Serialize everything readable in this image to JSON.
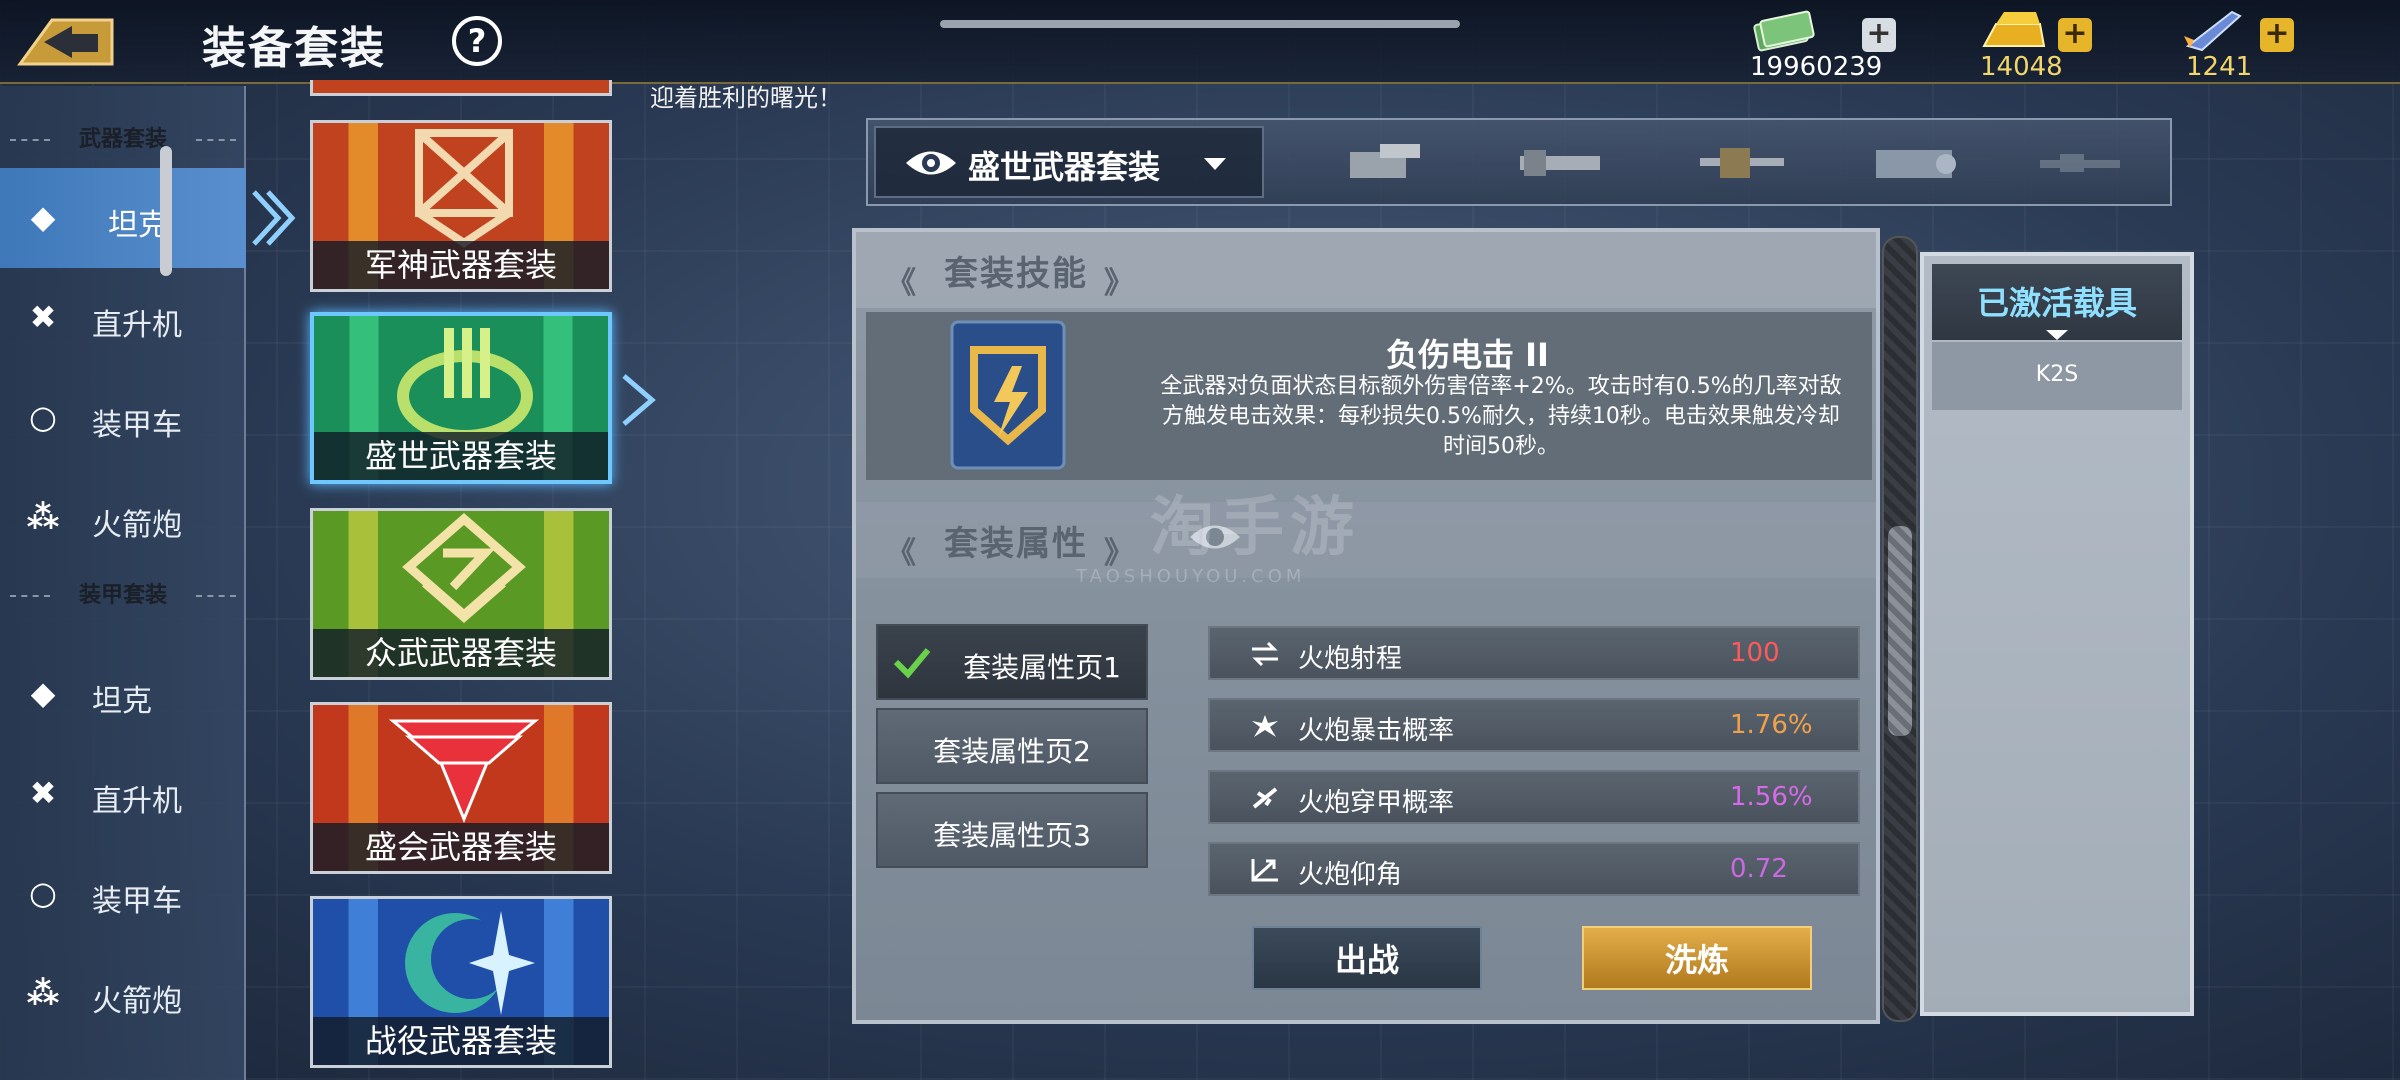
{
  "header": {
    "title": "装备套装",
    "help_label": "?",
    "resources": [
      {
        "icon": "cash-icon",
        "value": "19960239"
      },
      {
        "icon": "gold-bar-icon",
        "value": "14048"
      },
      {
        "icon": "rocket-icon",
        "value": "1241"
      }
    ],
    "plus_label": "+"
  },
  "marquee": "迎着胜利的曙光！",
  "category_nav": {
    "groups": [
      {
        "heading": "武器套装",
        "items": [
          {
            "label": "坦克",
            "symbol": "◆",
            "active": true
          },
          {
            "label": "直升机",
            "symbol": "✖",
            "active": false
          },
          {
            "label": "装甲车",
            "symbol": "○",
            "active": false
          },
          {
            "label": "火箭炮",
            "symbol": "⁂",
            "active": false
          }
        ]
      },
      {
        "heading": "装甲套装",
        "items": [
          {
            "label": "坦克",
            "symbol": "◆",
            "active": false
          },
          {
            "label": "直升机",
            "symbol": "✖",
            "active": false
          },
          {
            "label": "装甲车",
            "symbol": "○",
            "active": false
          },
          {
            "label": "火箭炮",
            "symbol": "⁂",
            "active": false
          }
        ]
      }
    ]
  },
  "sets": [
    {
      "name": "军神武器套装",
      "colors": [
        "#c0421e",
        "#e38a2a"
      ],
      "emblem": "crossed-emblem-icon"
    },
    {
      "name": "盛世武器套装",
      "colors": [
        "#1a8f5a",
        "#34c07a"
      ],
      "emblem": "wreath-emblem-icon",
      "active": true
    },
    {
      "name": "众武武器套装",
      "colors": [
        "#5a9a24",
        "#a8c03a"
      ],
      "emblem": "chevron-emblem-icon"
    },
    {
      "name": "盛会武器套装",
      "colors": [
        "#c2381c",
        "#e0782a"
      ],
      "emblem": "eagle-emblem-icon"
    },
    {
      "name": "战役武器套装",
      "colors": [
        "#1f4fa8",
        "#3f7fd8"
      ],
      "emblem": "crescent-star-emblem-icon"
    }
  ],
  "weapon_bar": {
    "selected_set": "盛世武器套装",
    "weapons": [
      "cannon-icon",
      "gatling-icon",
      "machine-gun-icon",
      "rocket-pod-icon",
      "rifle-icon"
    ]
  },
  "skill": {
    "section_title": "套装技能",
    "name": "负伤电击 II",
    "description": "全武器对负面状态目标额外伤害倍率+2%。攻击时有0.5%的几率对敌方触发电击效果：每秒损失0.5%耐久，持续10秒。电击效果触发冷却时间50秒。"
  },
  "attributes": {
    "section_title": "套装属性",
    "pages": [
      {
        "label": "套装属性页1",
        "active": true
      },
      {
        "label": "套装属性页2",
        "active": false
      },
      {
        "label": "套装属性页3",
        "active": false
      }
    ],
    "rows": [
      {
        "icon": "range-icon",
        "name": "火炮射程",
        "value": "100",
        "color": "#ff5a5a"
      },
      {
        "icon": "crit-icon",
        "name": "火炮暴击概率",
        "value": "1.76%",
        "color": "#f0a24a"
      },
      {
        "icon": "pierce-icon",
        "name": "火炮穿甲概率",
        "value": "1.56%",
        "color": "#d66ae8"
      },
      {
        "icon": "elevation-icon",
        "name": "火炮仰角",
        "value": "0.72",
        "color": "#c86ae0"
      }
    ]
  },
  "actions": {
    "deploy": "出战",
    "refine": "洗炼"
  },
  "vehicles": {
    "title": "已激活载具",
    "items": [
      "K2S"
    ]
  },
  "watermark": {
    "main": "淘手游",
    "sub": "TAOSHOUYOU.COM"
  }
}
